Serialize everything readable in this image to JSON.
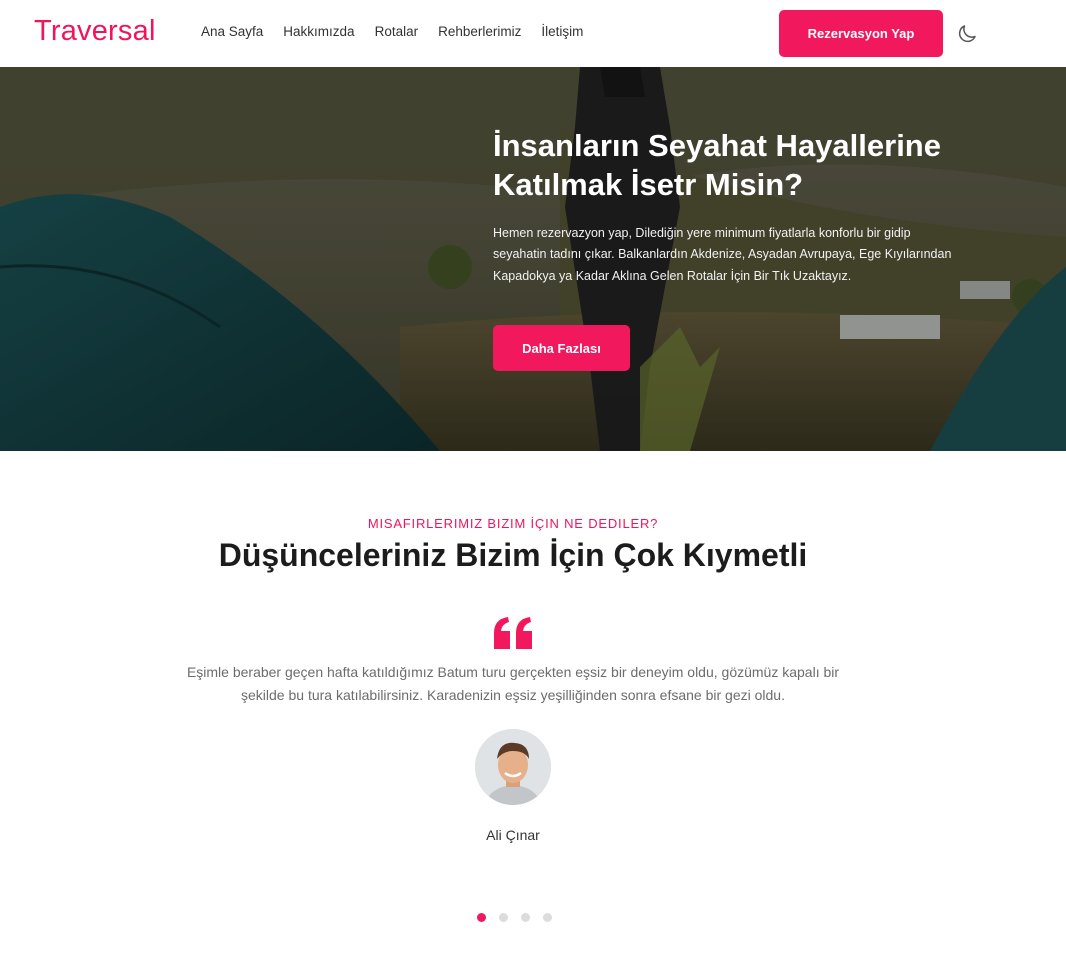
{
  "header": {
    "logo": "Traversal",
    "nav": [
      "Ana Sayfa",
      "Hakkımızda",
      "Rotalar",
      "Rehberlerimiz",
      "İletişim"
    ],
    "reserve_label": "Rezervasyon Yap",
    "theme_icon": "moon-icon"
  },
  "hero": {
    "title_line1": "İnsanların Seyahat Hayallerine",
    "title_line2": "Katılmak İsetr Misin?",
    "text": "Hemen rezervazyon yap, Dilediğin yere minimum fiyatlarla konforlu bir gidip seyahatin tadını çıkar. Balkanlardın Akdenize, Asyadan Avrupaya, Ege Kıyılarından Kapadokya ya Kadar Aklına Gelen Rotalar İçin Bir Tık Uzaktayız.",
    "button_label": "Daha Fazlası"
  },
  "testimonials": {
    "eyebrow": "MISAFIRLERIMIZ BIZIM İÇIN NE DEDILER?",
    "title": "Düşünceleriniz Bizim İçin Çok Kıymetli",
    "quote": "Eşimle beraber geçen hafta katıldığımız Batum turu gerçekten eşsiz bir deneyim oldu, gözümüz kapalı bir şekilde bu tura katılabilirsiniz. Karadenizin eşsiz yeşilliğinden sonra efsane bir gezi oldu.",
    "author": "Ali Çınar",
    "slides": 4,
    "active_slide": 1
  },
  "colors": {
    "accent": "#f2185d"
  }
}
